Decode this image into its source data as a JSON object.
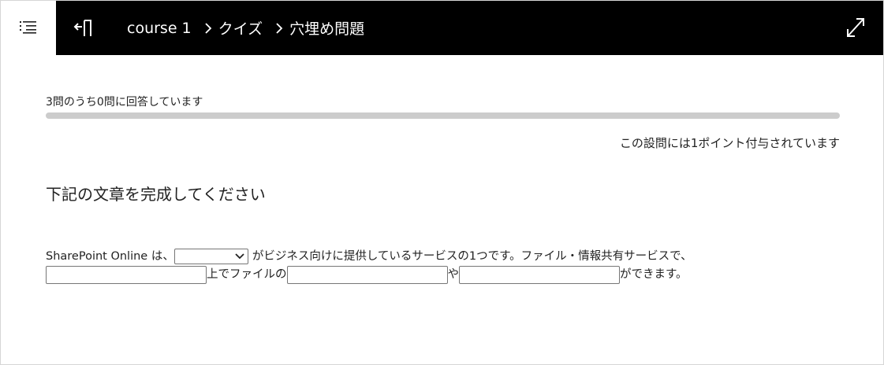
{
  "header": {
    "breadcrumb": {
      "course": "course 1",
      "section": "クイズ",
      "current": "穴埋め問題"
    },
    "colors": {
      "bar": "#000000",
      "text": "#ffffff"
    }
  },
  "quiz": {
    "progress_text": "3問のうち0問に回答しています",
    "answered": 0,
    "total": 3,
    "points_text": "この設問には1ポイント付与されています",
    "title": "下記の文章を完成してください",
    "line1": {
      "before": "SharePoint Online は、",
      "after": "がビジネス向けに提供しているサービスの1つです。ファイル・情報共有サービスで、"
    },
    "dropdown": {
      "selected": ""
    },
    "line2": {
      "blank1_value": "",
      "after1": "上でファイルの",
      "blank2_value": "",
      "after2": "や",
      "blank3_value": "",
      "after3": "ができます。"
    }
  },
  "icons": {
    "menu": "menu-list-icon",
    "exit": "exit-door-icon",
    "separator": "chevron-right-icon",
    "expand": "expand-diagonal-icon",
    "dropdown": "chevron-down-icon"
  }
}
